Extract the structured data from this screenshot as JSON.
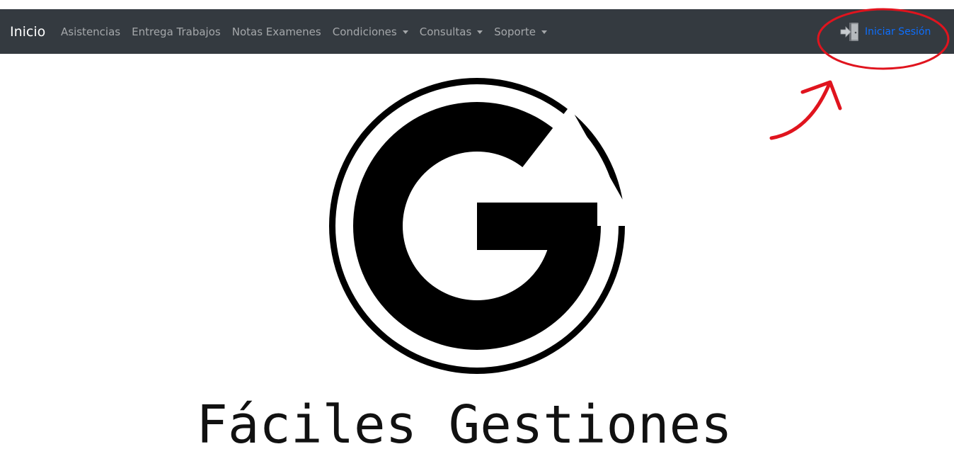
{
  "navbar": {
    "brand": "Inicio",
    "links": [
      {
        "label": "Asistencias"
      },
      {
        "label": "Entrega Trabajos"
      },
      {
        "label": "Notas Examenes"
      },
      {
        "label": "Condiciones"
      },
      {
        "label": "Consultas"
      },
      {
        "label": "Soporte"
      }
    ],
    "login_label": "Iniciar Sesión",
    "login_icon": "door-enter-icon",
    "background_color": "#343a40",
    "login_color": "#0d6efd"
  },
  "main": {
    "title": "Fáciles Gestiones",
    "logo": "letter-g-logo"
  },
  "annotation": {
    "color": "#e0141e",
    "shapes": [
      "highlight-ellipse",
      "pointer-arrow"
    ]
  }
}
